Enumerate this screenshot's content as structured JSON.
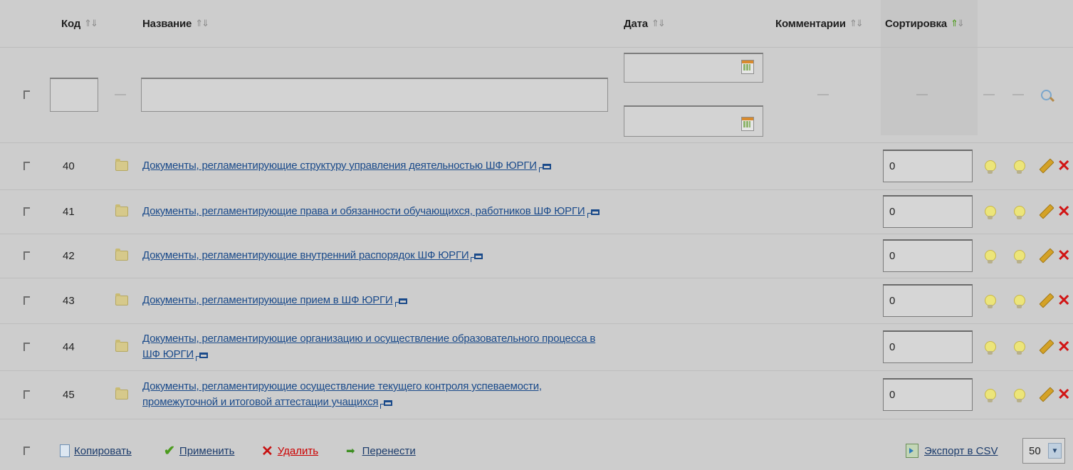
{
  "header": {
    "col_code": "Код",
    "col_name": "Название",
    "col_date": "Дата",
    "col_comments": "Комментарии",
    "col_sort": "Сортировка",
    "sort_arrows": "⇑⇓"
  },
  "filter": {
    "dash": "—",
    "code_value": "",
    "name_value": "",
    "date_from": "",
    "date_to": ""
  },
  "rows": [
    {
      "id": "40",
      "title": "Документы, регламентирующие структуру управления деятельностью ШФ ЮРГИ",
      "sort": "0"
    },
    {
      "id": "41",
      "title": "Документы, регламентирующие права и обязанности обучающихся, работников ШФ ЮРГИ",
      "sort": "0"
    },
    {
      "id": "42",
      "title": "Документы, регламентирующие внутренний распорядок ШФ ЮРГИ",
      "sort": "0"
    },
    {
      "id": "43",
      "title": "Документы, регламентирующие прием в ШФ ЮРГИ",
      "sort": "0"
    },
    {
      "id": "44",
      "title": "Документы, регламентирующие организацию и осуществление образовательного процесса в ШФ ЮРГИ",
      "sort": "0"
    },
    {
      "id": "45",
      "title": "Документы, регламентирующие осуществление текущего контроля успеваемости, промежуточной и итоговой аттестации учащихся",
      "sort": "0"
    }
  ],
  "footer": {
    "copy": "Копировать",
    "apply": "Применить",
    "delete": "Удалить",
    "move": "Перенести",
    "export": "Экспорт в CSV",
    "per_page": "50"
  },
  "icons": [
    "checkbox-icon",
    "folder-icon",
    "external-link-icon",
    "bulb-icon",
    "pencil-icon",
    "delete-icon",
    "calendar-icon",
    "search-icon",
    "copy-icon",
    "check-icon",
    "arrow-right-icon",
    "csv-icon",
    "chevron-down-icon"
  ]
}
